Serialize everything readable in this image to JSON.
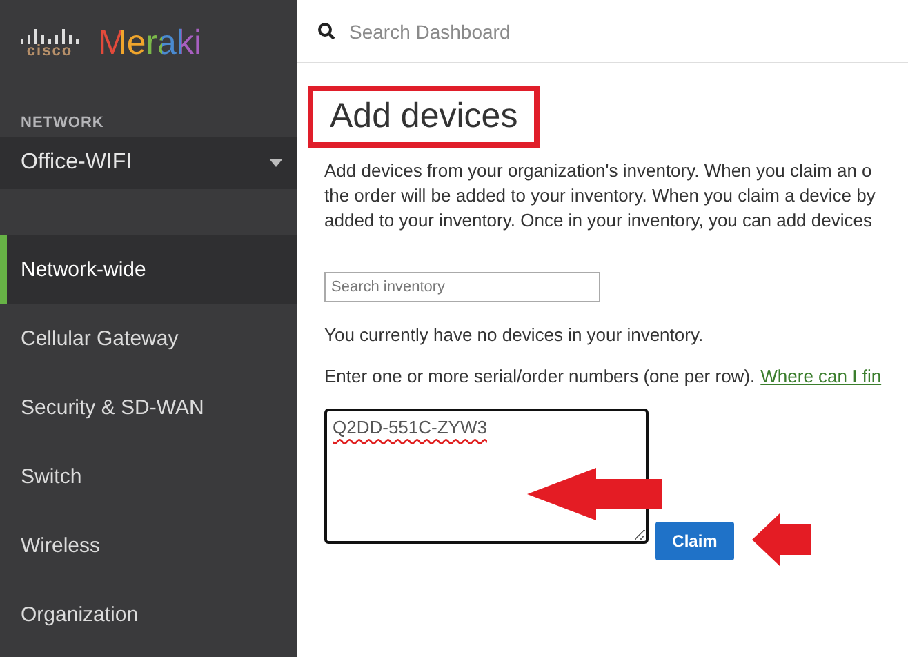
{
  "logo": {
    "brand": "cisco",
    "product": "Meraki"
  },
  "sidebar": {
    "section_label": "NETWORK",
    "network_select": {
      "value": "Office-WIFI"
    },
    "items": [
      {
        "label": "Network-wide",
        "selected": true
      },
      {
        "label": "Cellular Gateway",
        "selected": false
      },
      {
        "label": "Security & SD-WAN",
        "selected": false
      },
      {
        "label": "Switch",
        "selected": false
      },
      {
        "label": "Wireless",
        "selected": false
      },
      {
        "label": "Organization",
        "selected": false
      }
    ]
  },
  "search": {
    "placeholder": "Search Dashboard"
  },
  "page": {
    "title": "Add devices",
    "intro_lines": [
      "Add devices from your organization's inventory. When you claim an o",
      "the order will be added to your inventory. When you claim a device by",
      "added to your inventory. Once in your inventory, you can add devices"
    ],
    "inventory_search": {
      "placeholder": "Search inventory"
    },
    "empty_message": "You currently have no devices in your inventory.",
    "serial_prompt": "Enter one or more serial/order numbers (one per row).",
    "help_link": "Where can I fin",
    "serials": {
      "value": "Q2DD-551C-ZYW3"
    },
    "claim_button": "Claim"
  }
}
